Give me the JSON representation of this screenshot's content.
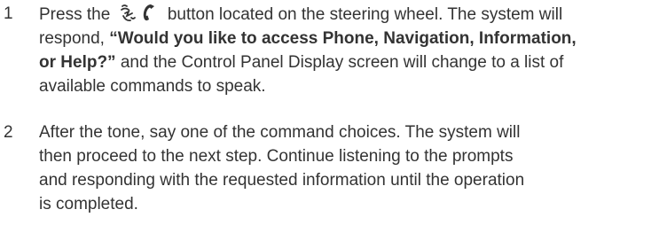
{
  "steps": [
    {
      "number": "1",
      "text_before_icon": "Press the",
      "icon": "voice-command-icon",
      "text_after_icon": "button located on the steering wheel. The system will",
      "line2_prefix": "respond,",
      "quote_part1": "“Would you like to access Phone, Navigation, Information,",
      "quote_part2": "or Help?”",
      "line3_rest": "and the Control Panel Display screen will change to a list of",
      "line4": "available commands to speak."
    },
    {
      "number": "2",
      "lines": [
        "After the tone, say one of the command choices. The system will",
        "then proceed to the next step. Continue listening to the prompts",
        "and responding with the requested information until the operation",
        "is completed."
      ]
    }
  ]
}
